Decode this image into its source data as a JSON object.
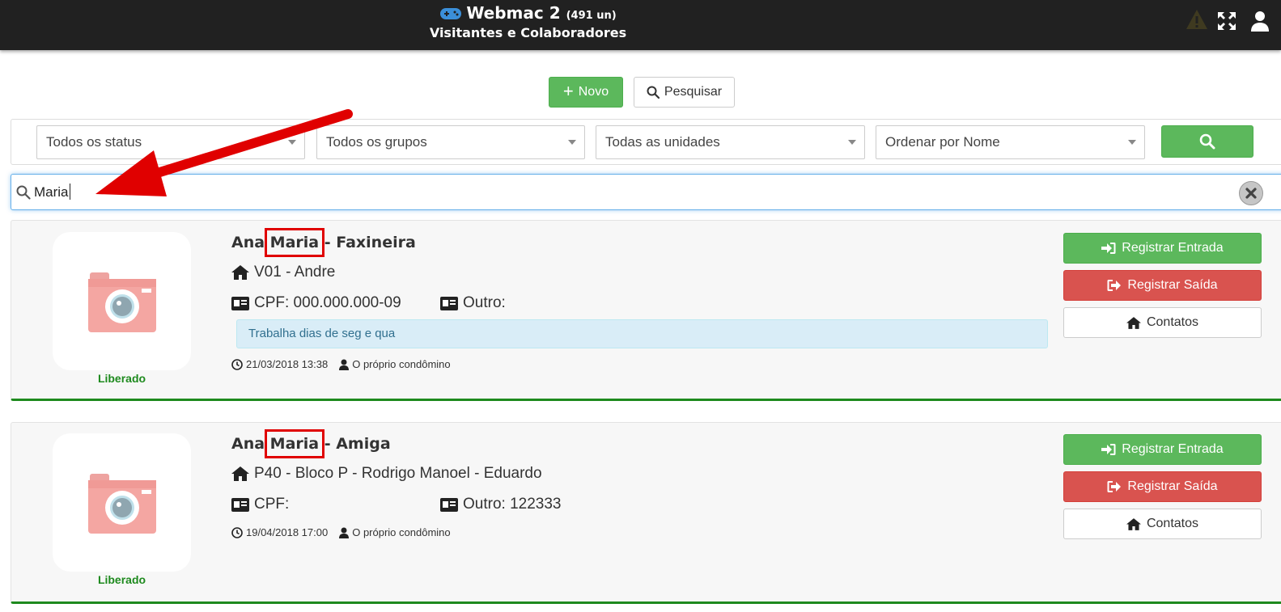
{
  "header": {
    "app_name": "Webmac 2",
    "count": "(491 un)",
    "subtitle": "Visitantes e Colaboradores",
    "icons": [
      "gamepad-icon",
      "warning-icon",
      "fullscreen-icon",
      "user-icon"
    ]
  },
  "toolbar": {
    "new_label": "Novo",
    "search_label": "Pesquisar"
  },
  "filters": {
    "status": "Todos os status",
    "groups": "Todos os grupos",
    "units": "Todas as unidades",
    "order": "Ordenar por Nome"
  },
  "search": {
    "value": "Maria"
  },
  "cards": [
    {
      "name_prefix": "Ana ",
      "name_highlight": "Maria",
      "name_suffix": " - Faxineira",
      "unit": "V01 - Andre",
      "cpf": "CPF: 000.000.000-09",
      "other": "Outro:",
      "note": "Trabalha dias de seg e qua",
      "datetime": "21/03/2018 13:38",
      "author": "O próprio condômino",
      "status": "Liberado",
      "btn_entry": "Registrar Entrada",
      "btn_exit": "Registrar Saída",
      "btn_contacts": "Contatos"
    },
    {
      "name_prefix": "Ana ",
      "name_highlight": "Maria",
      "name_suffix": " - Amiga",
      "unit": "P40 - Bloco P - Rodrigo Manoel - Eduardo",
      "cpf": "CPF:",
      "other": "Outro: 122333",
      "datetime": "19/04/2018 17:00",
      "author": "O próprio condômino",
      "status": "Liberado",
      "btn_entry": "Registrar Entrada",
      "btn_exit": "Registrar Saída",
      "btn_contacts": "Contatos"
    }
  ],
  "colors": {
    "topbar": "#212121",
    "green": "#5cb85c",
    "red": "#d9534f",
    "status_green": "#1e8a1e",
    "note_bg": "#d9edf7",
    "annotation": "#e00000"
  }
}
